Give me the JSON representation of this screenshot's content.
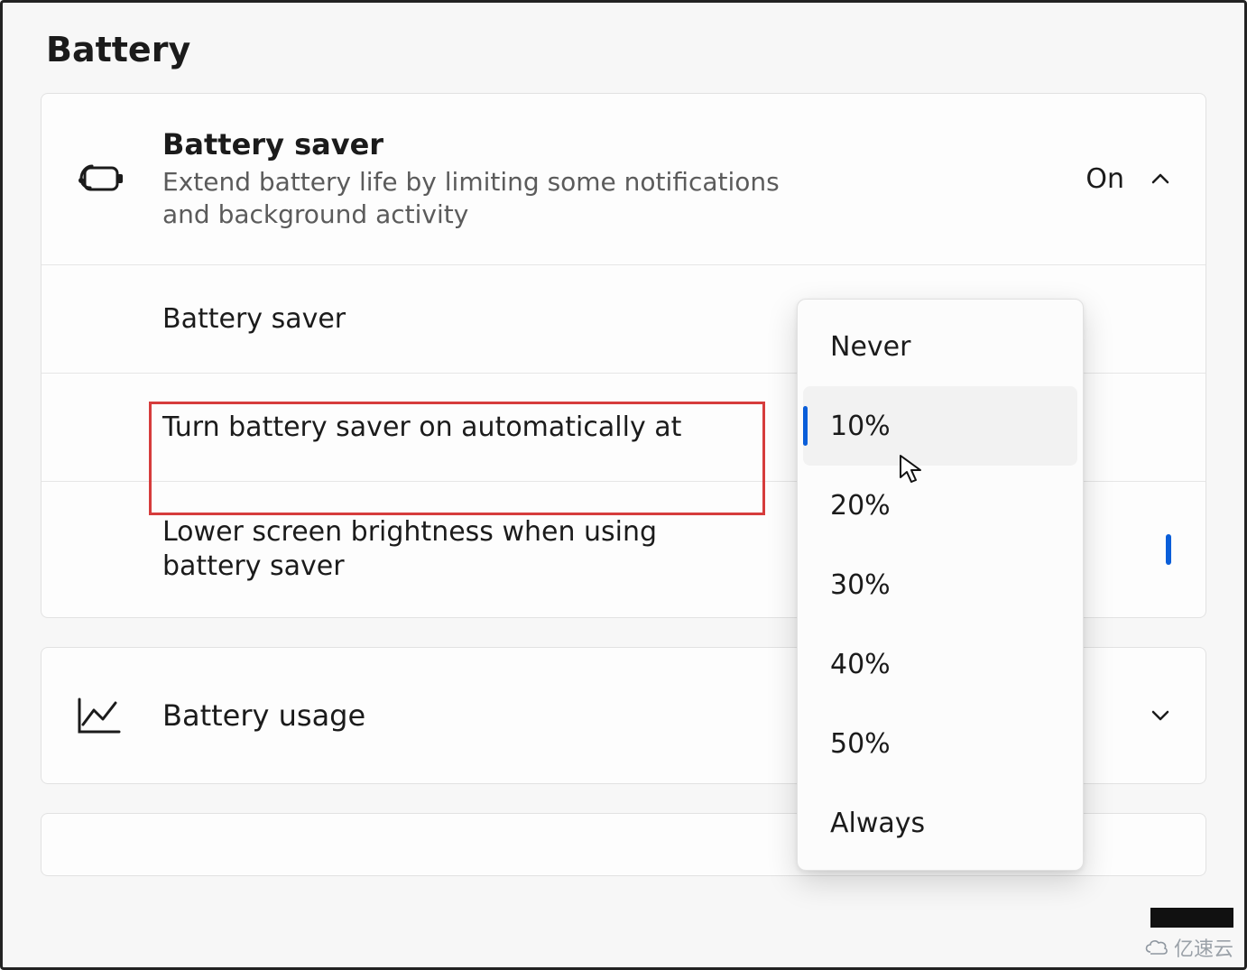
{
  "page": {
    "title": "Battery"
  },
  "battery_saver": {
    "header": {
      "title": "Battery saver",
      "subtitle": "Extend battery life by limiting some notifications and background activity",
      "status": "On"
    },
    "rows": {
      "toggle_label": "Battery saver",
      "auto_on_label": "Turn battery saver on automatically at",
      "brightness_label": "Lower screen brightness when using battery saver"
    }
  },
  "battery_usage": {
    "title": "Battery usage"
  },
  "dropdown": {
    "selected_index": 1,
    "options": [
      "Never",
      "10%",
      "20%",
      "30%",
      "40%",
      "50%",
      "Always"
    ]
  },
  "watermark": {
    "text": "亿速云"
  }
}
